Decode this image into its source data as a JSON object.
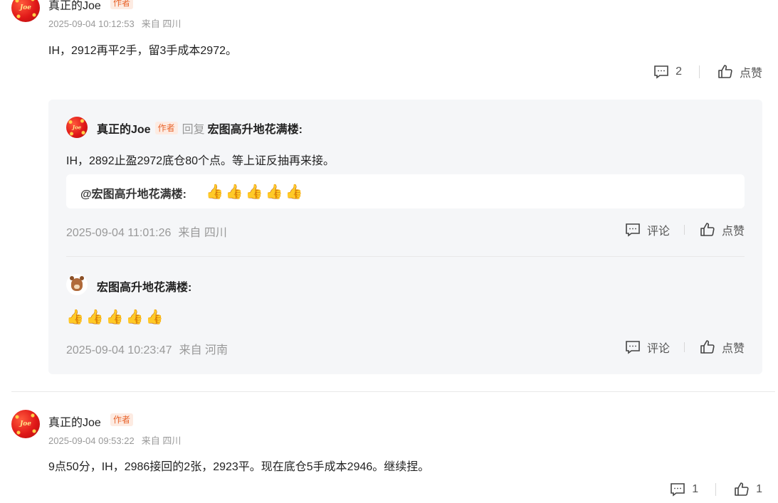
{
  "comments": [
    {
      "author": "真正的Joe",
      "badge": "作者",
      "avatar_text": "Joe",
      "time": "2025-09-04 10:12:53",
      "location": "来自 四川",
      "content": "IH，2912再平2手，留3手成本2972。",
      "comment_count": "2",
      "like_label": "点赞",
      "replies": [
        {
          "author": "真正的Joe",
          "badge": "作者",
          "reply_word": "回复",
          "reply_to": "宏图高升地花满楼:",
          "content": "IH，2892止盈2972底仓80个点。等上证反抽再来接。",
          "quote_author": "@宏图高升地花满楼:",
          "quote_emoji": "👍",
          "time": "2025-09-04 11:01:26",
          "location": "来自 四川",
          "comment_label": "评论",
          "like_label": "点赞"
        },
        {
          "author": "宏图高升地花满楼:",
          "emoji": "👍",
          "time": "2025-09-04 10:23:47",
          "location": "来自 河南",
          "comment_label": "评论",
          "like_label": "点赞"
        }
      ]
    },
    {
      "author": "真正的Joe",
      "badge": "作者",
      "avatar_text": "Joe",
      "time": "2025-09-04 09:53:22",
      "location": "来自 四川",
      "content": "9点50分，IH，2986接回的2张，2923平。现在底仓5手成本2946。继续捏。",
      "comment_count": "1",
      "like_count": "1"
    }
  ],
  "icons": {
    "comment": "comment-bubble-icon",
    "like": "thumbs-up-icon"
  },
  "colors": {
    "badge_text": "#e8642c",
    "badge_bg": "#fdebe2",
    "reply_bg": "#f5f6f8",
    "meta": "#999999"
  }
}
